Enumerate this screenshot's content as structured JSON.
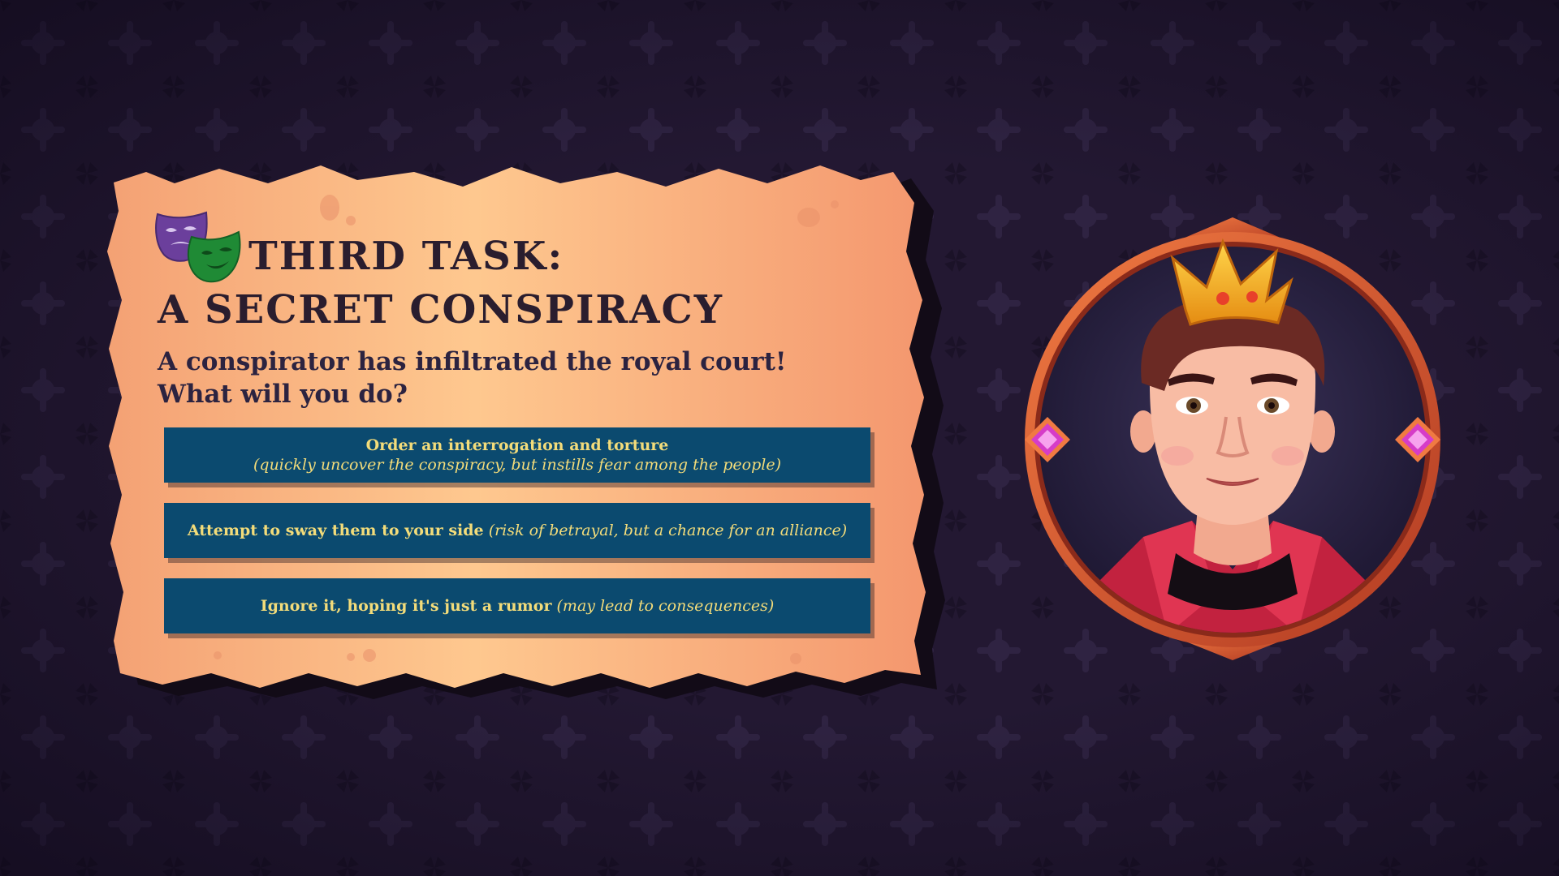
{
  "task": {
    "title_line_1": "THIRD TASK:",
    "title_line_2": "A SECRET CONSPIRACY",
    "subtitle_line_1": "A conspirator has infiltrated the royal court!",
    "subtitle_line_2": "What will you do?"
  },
  "choices": [
    {
      "label": "Order an interrogation and torture",
      "detail": "(quickly uncover the conspiracy, but instills fear among the people)"
    },
    {
      "label": "Attempt to sway them to your side",
      "detail": "(risk of betrayal, but a chance for an alliance)"
    },
    {
      "label": "Ignore it, hoping it's just a rumor",
      "detail": "(may lead to consequences)"
    }
  ],
  "icons": {
    "masks": "theatre-masks-icon",
    "portrait": "king-portrait",
    "gems": "gem-icon"
  },
  "colors": {
    "background": "#231832",
    "parchment_light": "#fdc98f",
    "parchment_dark": "#f59a6f",
    "button_bg": "#0b4a6f",
    "button_text": "#f3dc7a",
    "title_text": "#2a1d2e",
    "frame": "#d9532f",
    "gem": "#d63cc8"
  }
}
